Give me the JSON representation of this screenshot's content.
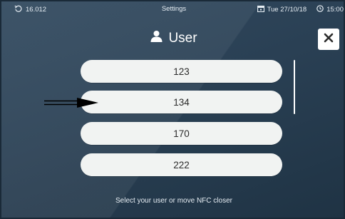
{
  "status_bar": {
    "left_value": "16.012",
    "title": "Settings",
    "date": "Tue 27/10/18",
    "time": "15:00"
  },
  "header": {
    "title": "User"
  },
  "users": [
    "123",
    "134",
    "170",
    "222"
  ],
  "footer": {
    "instruction": "Select your user or move NFC closer"
  },
  "icons": {
    "status_left": "sync-icon",
    "calendar": "calendar-icon",
    "clock": "clock-icon",
    "user": "user-icon",
    "close": "close-icon",
    "pointer": "arrow-right-icon"
  },
  "colors": {
    "screen_bg": "#2a4054",
    "button_bg": "#f1f3f2",
    "text_light": "#e6edf3"
  }
}
